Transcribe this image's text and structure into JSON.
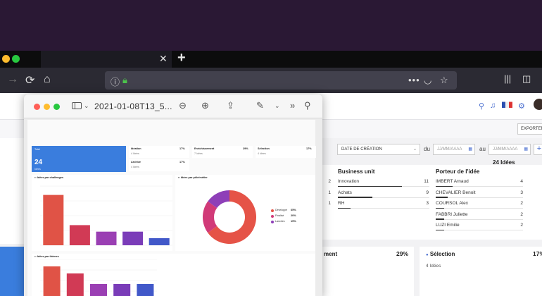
{
  "preview": {
    "title": "2021-01-08T13_5..."
  },
  "app": {
    "export_label": "EXPORTER",
    "date_filter_label": "DATE DE CRÉATION",
    "du_label": "du",
    "au_label": "au",
    "date_placeholder": "JJ/MM/AAAA",
    "ideas_count": "24 Idées",
    "business_unit": {
      "title": "Business unit",
      "left_values": [
        "2",
        "1",
        "1"
      ],
      "rows": [
        {
          "label": "Innovation",
          "value": "11",
          "fraction": 0.7
        },
        {
          "label": "Achats",
          "value": "9",
          "fraction": 0.38
        },
        {
          "label": "RH",
          "value": "3",
          "fraction": 0.14
        }
      ]
    },
    "porteur": {
      "title": "Porteur de l'idée",
      "rows": [
        {
          "label": "IMBERT Arnaud",
          "value": "4",
          "fraction": 0.19
        },
        {
          "label": "CHEVALIER Benoit",
          "value": "3",
          "fraction": 0.14
        },
        {
          "label": "COURSOL Alex",
          "value": "2",
          "fraction": 0.1
        },
        {
          "label": "FABBRI Juliette",
          "value": "2",
          "fraction": 0.1
        },
        {
          "label": "LUZI Emilie",
          "value": "2",
          "fraction": 0.1
        }
      ]
    },
    "stats": [
      {
        "name": "ment",
        "pct": "29%"
      },
      {
        "name": "Sélection",
        "pct": "17%",
        "sub": "4 Idées"
      }
    ]
  },
  "report": {
    "total_label": "Total",
    "total_value": "24",
    "total_sub": "Idées",
    "mini_cards": [
      {
        "name": "Idéation",
        "pct": "17%",
        "sub": "4 Idées"
      },
      {
        "name": "Enrichissement",
        "pct": "29%",
        "sub": "7 Idées"
      },
      {
        "name": "Sélection",
        "pct": "17%",
        "sub": "4 Idées"
      },
      {
        "name": "Archive",
        "pct": "17%",
        "sub": "4 Idées"
      }
    ],
    "chart1_title": "Idées par challenges",
    "chart2_title": "Idées par pôle/métier",
    "chart3_title": "Idées par thèmes",
    "legend": [
      "Développé",
      "Finalisé",
      "Lancées"
    ],
    "legend_pcts": [
      "65%",
      "20%",
      "15%"
    ]
  },
  "chart_data": [
    {
      "type": "bar",
      "title": "Idées par challenges",
      "values": [
        8.5,
        3.4,
        2.3,
        2.3,
        1.2
      ],
      "colors": [
        "#e05346",
        "#d13a55",
        "#9a3fb3",
        "#7a3cb8",
        "#4158c9"
      ],
      "ylim": [
        0,
        10
      ]
    },
    {
      "type": "pie",
      "title": "Idées par pôle/métier",
      "labels": [
        "Développé",
        "Finalisé",
        "Lancées"
      ],
      "values": [
        65,
        20,
        15
      ],
      "colors": [
        "#e55347",
        "#d13a78",
        "#8e3fb8"
      ]
    },
    {
      "type": "bar",
      "title": "Idées par thèmes",
      "values": [
        5,
        4,
        2.5,
        2.5,
        2.5
      ],
      "colors": [
        "#e05346",
        "#d13a55",
        "#9a3fb3",
        "#7a3cb8",
        "#4158c9"
      ],
      "ylim": [
        0,
        6
      ]
    }
  ]
}
